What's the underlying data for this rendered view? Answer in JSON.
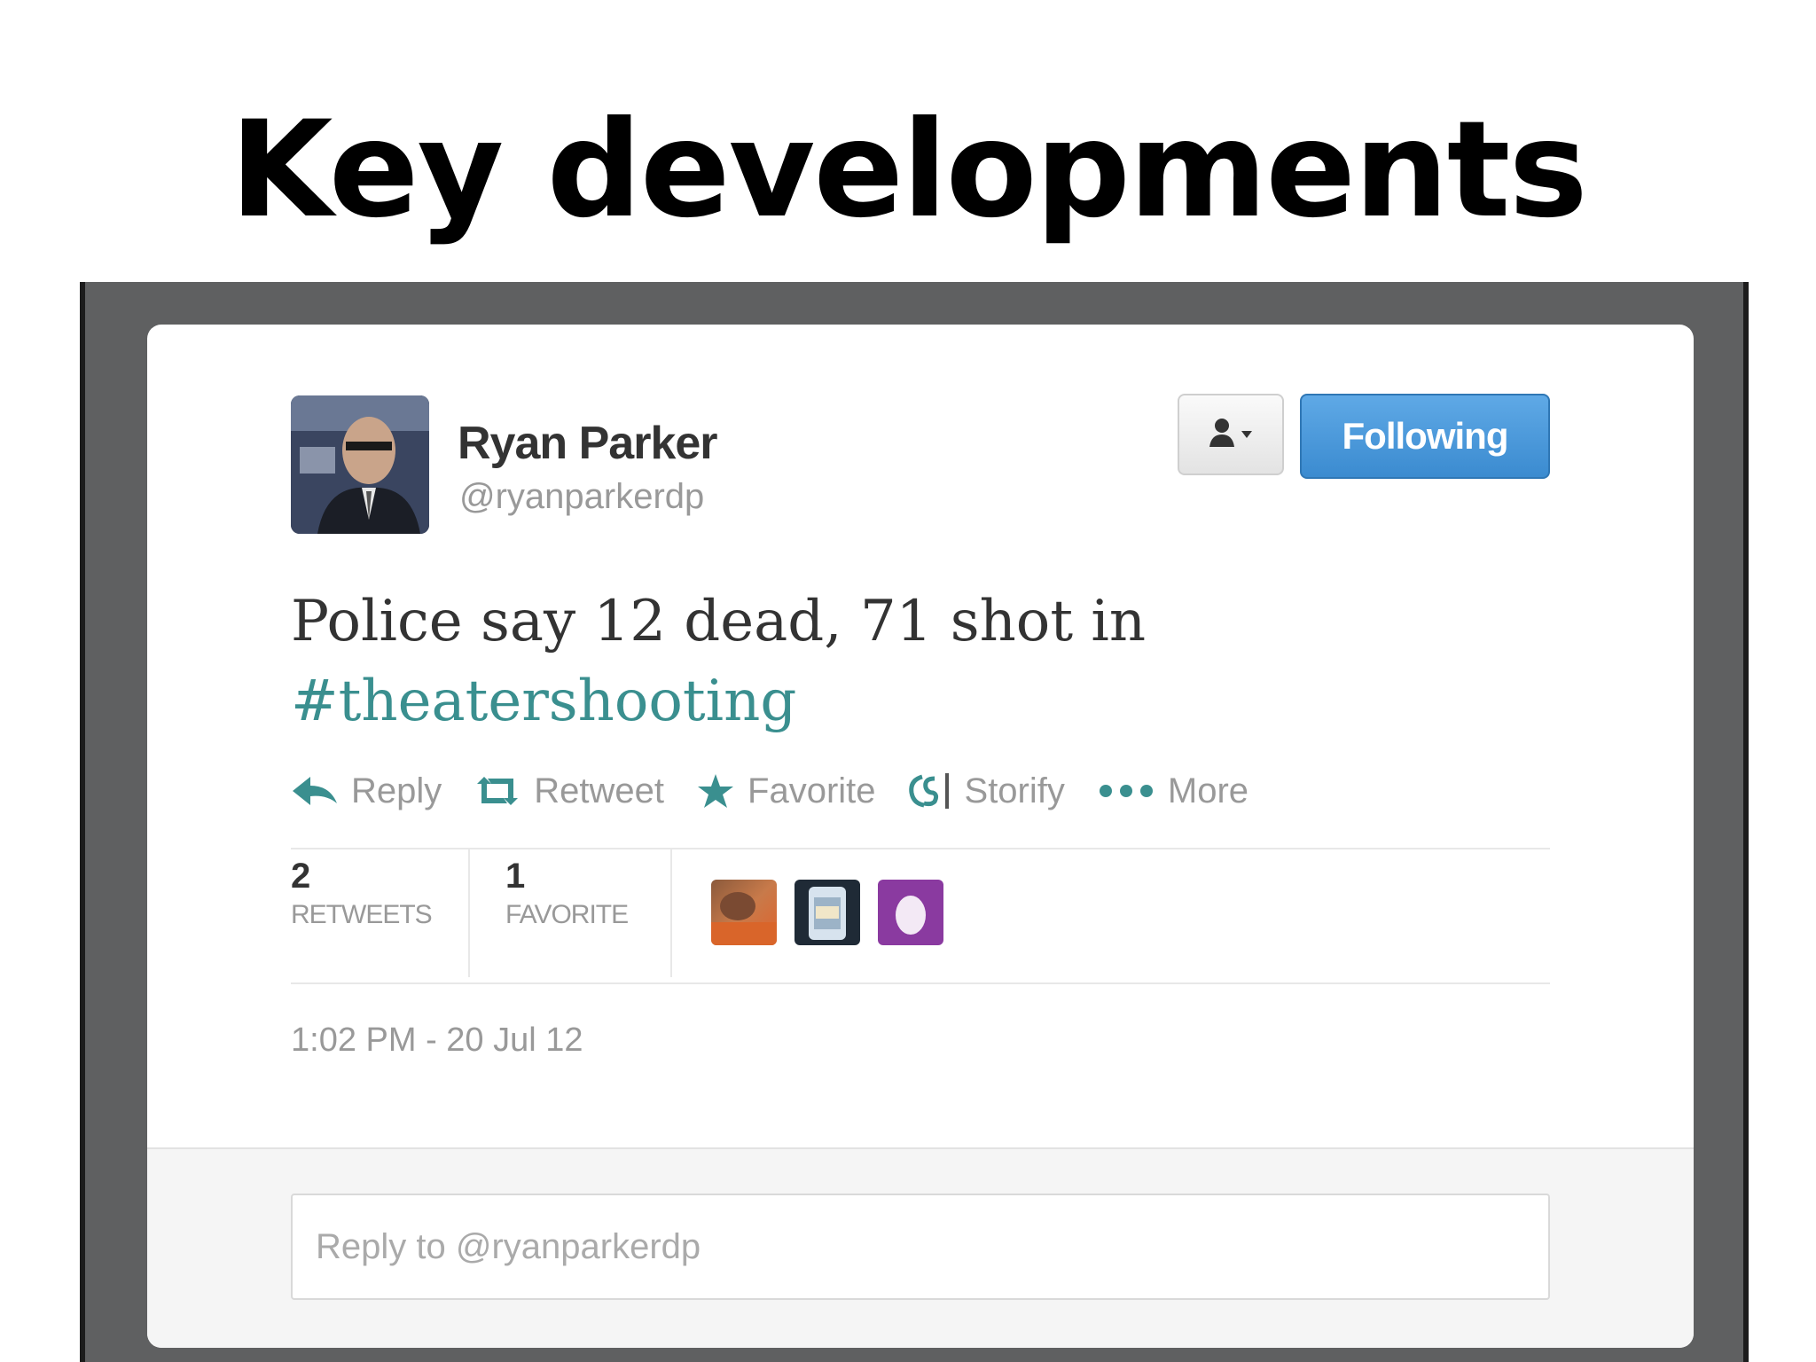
{
  "slide": {
    "title": "Key developments"
  },
  "tweet": {
    "author_name": "Ryan Parker",
    "author_handle": "@ryanparkerdp",
    "follow_label": "Following",
    "text_main": "Police say 12 dead, 71 shot in",
    "hashtag": "#theatershooting",
    "actions": {
      "reply": "Reply",
      "retweet": "Retweet",
      "favorite": "Favorite",
      "storify": "Storify",
      "more": "More"
    },
    "stats": {
      "retweets_count": "2",
      "retweets_label": "RETWEETS",
      "favorites_count": "1",
      "favorites_label": "FAVORITE"
    },
    "timestamp": "1:02 PM - 20 Jul 12",
    "reply_placeholder": "Reply to @ryanparkerdp"
  },
  "colors": {
    "follow_button": "#4a9bdc",
    "hashtag": "#3a8f8f",
    "action_icon": "#3a8f8f",
    "frame": "#5f6061"
  },
  "icons": {
    "reply": "reply-arrow-icon",
    "retweet": "retweet-icon",
    "favorite": "star-icon",
    "storify": "storify-icon",
    "more": "dots-icon",
    "user_menu": "user-dropdown-icon"
  }
}
